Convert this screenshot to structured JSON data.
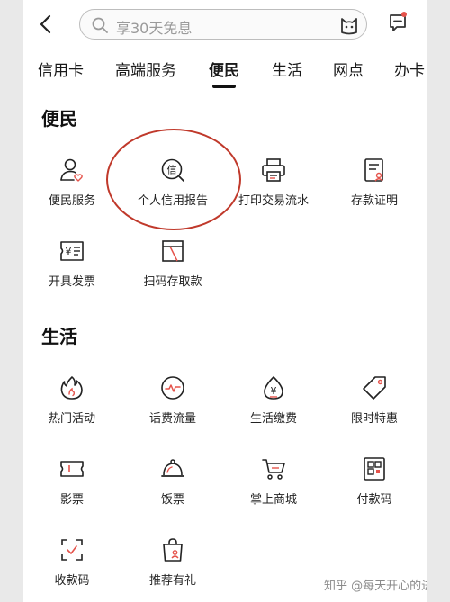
{
  "search": {
    "placeholder": "享30天免息"
  },
  "tabs": [
    {
      "label": "信用卡"
    },
    {
      "label": "高端服务"
    },
    {
      "label": "便民"
    },
    {
      "label": "生活"
    },
    {
      "label": "网点"
    },
    {
      "label": "办卡"
    }
  ],
  "sections": {
    "bianmin": {
      "title": "便民",
      "items": [
        {
          "label": "便民服务",
          "icon": "user-heart-icon"
        },
        {
          "label": "个人信用报告",
          "icon": "credit-report-icon"
        },
        {
          "label": "打印交易流水",
          "icon": "printer-icon"
        },
        {
          "label": "存款证明",
          "icon": "deposit-certificate-icon"
        },
        {
          "label": "开具发票",
          "icon": "invoice-icon"
        },
        {
          "label": "扫码存取款",
          "icon": "scan-cash-icon"
        }
      ]
    },
    "shenghuo": {
      "title": "生活",
      "items": [
        {
          "label": "热门活动",
          "icon": "flame-icon"
        },
        {
          "label": "话费流量",
          "icon": "phone-data-icon"
        },
        {
          "label": "生活缴费",
          "icon": "payment-drop-icon"
        },
        {
          "label": "限时特惠",
          "icon": "price-tag-icon"
        },
        {
          "label": "影票",
          "icon": "movie-ticket-icon"
        },
        {
          "label": "饭票",
          "icon": "food-cloche-icon"
        },
        {
          "label": "掌上商城",
          "icon": "shopping-cart-icon"
        },
        {
          "label": "付款码",
          "icon": "payment-qr-icon"
        },
        {
          "label": "收款码",
          "icon": "receive-code-icon"
        },
        {
          "label": "推荐有礼",
          "icon": "gift-bag-icon"
        }
      ]
    }
  },
  "watermark": "知乎 @每天开心的进步",
  "colors": {
    "accent": "#e5534b",
    "annotation_circle": "#c0392b",
    "text": "#1a1a1a"
  }
}
